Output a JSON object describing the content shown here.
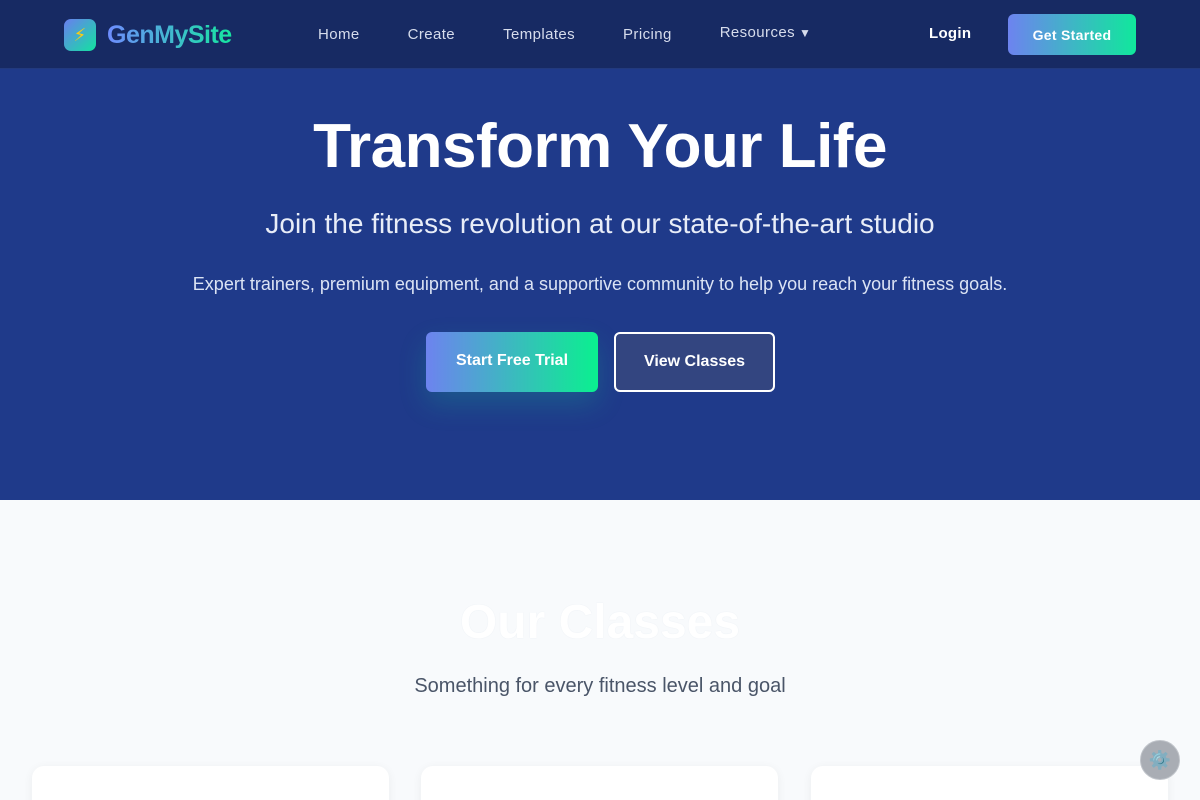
{
  "nav": {
    "brand": "GenMySite",
    "logo_icon": "⚡",
    "links": [
      "Home",
      "Create",
      "Templates",
      "Pricing"
    ],
    "resources_label": "Resources",
    "resources_caret": "▼",
    "login": "Login",
    "get_started": "Get Started"
  },
  "hero": {
    "title": "Transform Your Life",
    "subtitle": "Join the fitness revolution at our state-of-the-art studio",
    "description": "Expert trainers, premium equipment, and a supportive community to help you reach your fitness goals.",
    "primary_cta": "Start Free Trial",
    "secondary_cta": "View Classes"
  },
  "classes": {
    "title": "Our Classes",
    "subtitle": "Something for every fitness level and goal"
  },
  "settings_icon": "⚙️",
  "colors": {
    "nav_bg": "#172a63",
    "hero_bg": "#1f3a8a",
    "accent_start": "#6d83ef",
    "accent_end": "#10e89c",
    "section_bg": "#f8fafc"
  }
}
